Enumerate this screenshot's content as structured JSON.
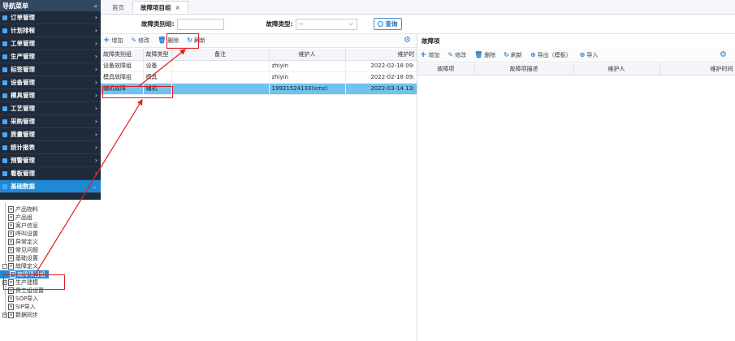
{
  "sidebar": {
    "title": "导航菜单",
    "collapse_symbol": "«",
    "menu": [
      {
        "label": "订单管理"
      },
      {
        "label": "计划排程"
      },
      {
        "label": "工单管理"
      },
      {
        "label": "生产管理"
      },
      {
        "label": "标签管理"
      },
      {
        "label": "设备管理"
      },
      {
        "label": "模具管理"
      },
      {
        "label": "工艺管理"
      },
      {
        "label": "采购管理"
      },
      {
        "label": "质量管理"
      },
      {
        "label": "统计报表"
      },
      {
        "label": "预警管理"
      },
      {
        "label": "看板管理"
      },
      {
        "label": "基础数据"
      }
    ],
    "tree": [
      {
        "label": "产品物料"
      },
      {
        "label": "产品组"
      },
      {
        "label": "客户信息"
      },
      {
        "label": "呼叫设置"
      },
      {
        "label": "异常定义"
      },
      {
        "label": "常见问题"
      },
      {
        "label": "基础设置"
      },
      {
        "label": "故障定义"
      },
      {
        "label": "故障项目组"
      },
      {
        "label": "生产建模"
      },
      {
        "label": "员工组设置"
      },
      {
        "label": "SOP导入"
      },
      {
        "label": "SIP导入"
      },
      {
        "label": "数据同步"
      }
    ]
  },
  "tabs": {
    "home": "首页",
    "current": "故障项目组",
    "close": "×"
  },
  "search": {
    "category_label": "故障类别组:",
    "category_value": "",
    "type_label": "故障类型:",
    "type_value": "--",
    "query_label": "查询"
  },
  "left_toolbar": {
    "add": "增加",
    "edit": "修改",
    "delete": "删除",
    "refresh": "刷新"
  },
  "left_table": {
    "headers": [
      "故障类别组",
      "故障类型",
      "备注",
      "维护人",
      "维护时"
    ],
    "rows": [
      [
        "设备故障组",
        "设备",
        "",
        "zhiyin",
        "2022-02-18 09:"
      ],
      [
        "模具故障组",
        "模具",
        "",
        "zhiyin",
        "2022-02-18 09:"
      ],
      [
        "辅机故障",
        "辅机",
        "",
        "19921524133(xmz)",
        "2022-03-14 13:"
      ]
    ],
    "selected_row": 2
  },
  "right_panel": {
    "title": "故障项",
    "toolbar": {
      "add": "增加",
      "edit": "修改",
      "delete": "删除",
      "refresh": "刷新",
      "export": "导出（模板）",
      "import": "导入"
    },
    "headers": [
      "故障项",
      "故障项描述",
      "维护人",
      "维护时间"
    ]
  },
  "colors": {
    "sidebar_bg": "#1f2a3a",
    "active_blue": "#1e8ad6",
    "selected_row": "#70c2f0",
    "annotation_red": "#e02020"
  }
}
